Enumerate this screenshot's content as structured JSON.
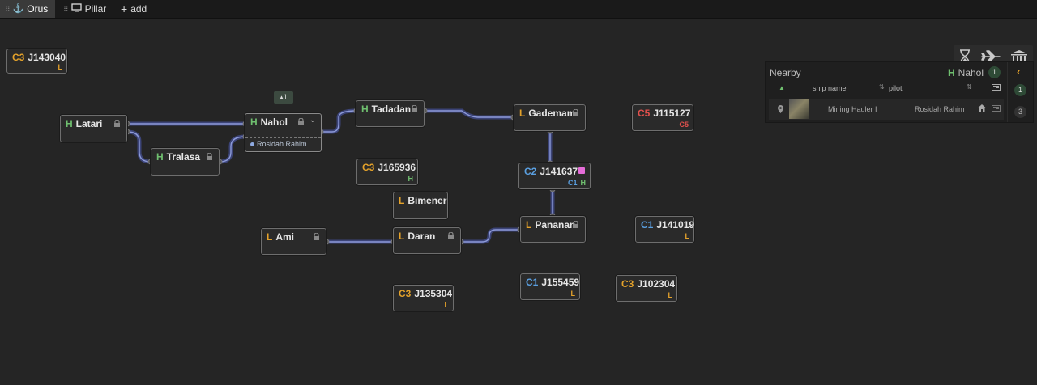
{
  "tabs": [
    {
      "label": "Orus",
      "icon": "anchor-icon"
    },
    {
      "label": "Pillar",
      "icon": "monitor-icon"
    },
    {
      "label": "add",
      "icon": "plus-icon"
    }
  ],
  "systems": {
    "j143040": {
      "class": "C3",
      "name": "J143040",
      "statics": [
        "L"
      ]
    },
    "latari": {
      "class": "H",
      "name": "Latari",
      "locked": true
    },
    "tralasa": {
      "class": "H",
      "name": "Tralasa",
      "locked": true
    },
    "nahol": {
      "class": "H",
      "name": "Nahol",
      "locked": true,
      "pilot": "Rosidah Rahim",
      "badge": "1"
    },
    "tadadan": {
      "class": "H",
      "name": "Tadadan",
      "locked": true
    },
    "gademam": {
      "class": "L",
      "name": "Gademam",
      "locked": true
    },
    "j115127": {
      "class": "C5",
      "name": "J115127",
      "statics": [
        "C5"
      ]
    },
    "j165936": {
      "class": "C3",
      "name": "J165936",
      "statics": [
        "H"
      ]
    },
    "j141637": {
      "class": "C2",
      "name": "J141637",
      "statics": [
        "C1",
        "H"
      ],
      "tag_color": "#e56cd8"
    },
    "bimener": {
      "class": "L",
      "name": "Bimener"
    },
    "pananan": {
      "class": "L",
      "name": "Pananan",
      "locked": true
    },
    "j141019": {
      "class": "C1",
      "name": "J141019",
      "statics": [
        "L"
      ]
    },
    "ami": {
      "class": "L",
      "name": "Ami",
      "locked": true
    },
    "daran": {
      "class": "L",
      "name": "Daran",
      "locked": true
    },
    "j135304": {
      "class": "C3",
      "name": "J135304",
      "statics": [
        "L"
      ]
    },
    "j155459": {
      "class": "C1",
      "name": "J155459",
      "statics": [
        "L"
      ]
    },
    "j102304": {
      "class": "C3",
      "name": "J102304",
      "statics": [
        "L"
      ]
    }
  },
  "toolbar": {
    "icons": [
      "hourglass-icon",
      "plane-icon",
      "bank-icon"
    ]
  },
  "nearby": {
    "title": "Nearby",
    "system_class": "H",
    "system_name": "Nahol",
    "count": "1",
    "columns": {
      "ship": "ship name",
      "pilot": "pilot"
    },
    "rows": [
      {
        "ship": "Mining Hauler I",
        "pilot": "Rosidah Rahim"
      }
    ],
    "side_counts": [
      "1",
      "3"
    ]
  }
}
